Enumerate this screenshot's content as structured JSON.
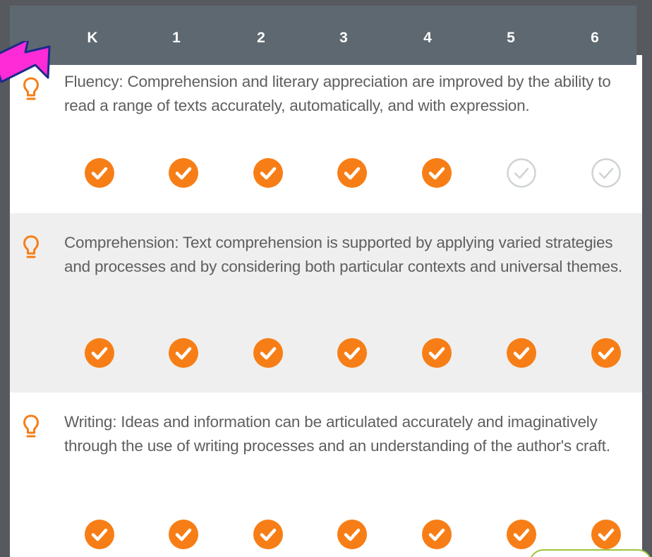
{
  "colors": {
    "accent": "#f77e16",
    "header_bg": "#5e6870",
    "unchecked": "#cfd3d6",
    "arrow": "#ff2bd6"
  },
  "grades": [
    "K",
    "1",
    "2",
    "3",
    "4",
    "5",
    "6"
  ],
  "strands": [
    {
      "icon": "lightbulb-icon",
      "text": "Fluency: Comprehension and literary appreciation are improved by the ability to read a range of texts accurately, automatically, and with expression.",
      "checks": [
        true,
        true,
        true,
        true,
        true,
        false,
        false
      ]
    },
    {
      "icon": "lightbulb-icon",
      "text": "Comprehension: Text comprehension is supported by applying varied strategies and processes and by considering both particular contexts and universal themes.",
      "checks": [
        true,
        true,
        true,
        true,
        true,
        true,
        true
      ]
    },
    {
      "icon": "lightbulb-icon",
      "text": "Writing: Ideas and information can be articulated accurately and imaginatively through the use of writing processes and an understanding of the author's craft.",
      "checks": [
        true,
        true,
        true,
        true,
        true,
        true,
        true
      ]
    }
  ],
  "annotation": {
    "icon": "pointer-arrow-icon"
  }
}
